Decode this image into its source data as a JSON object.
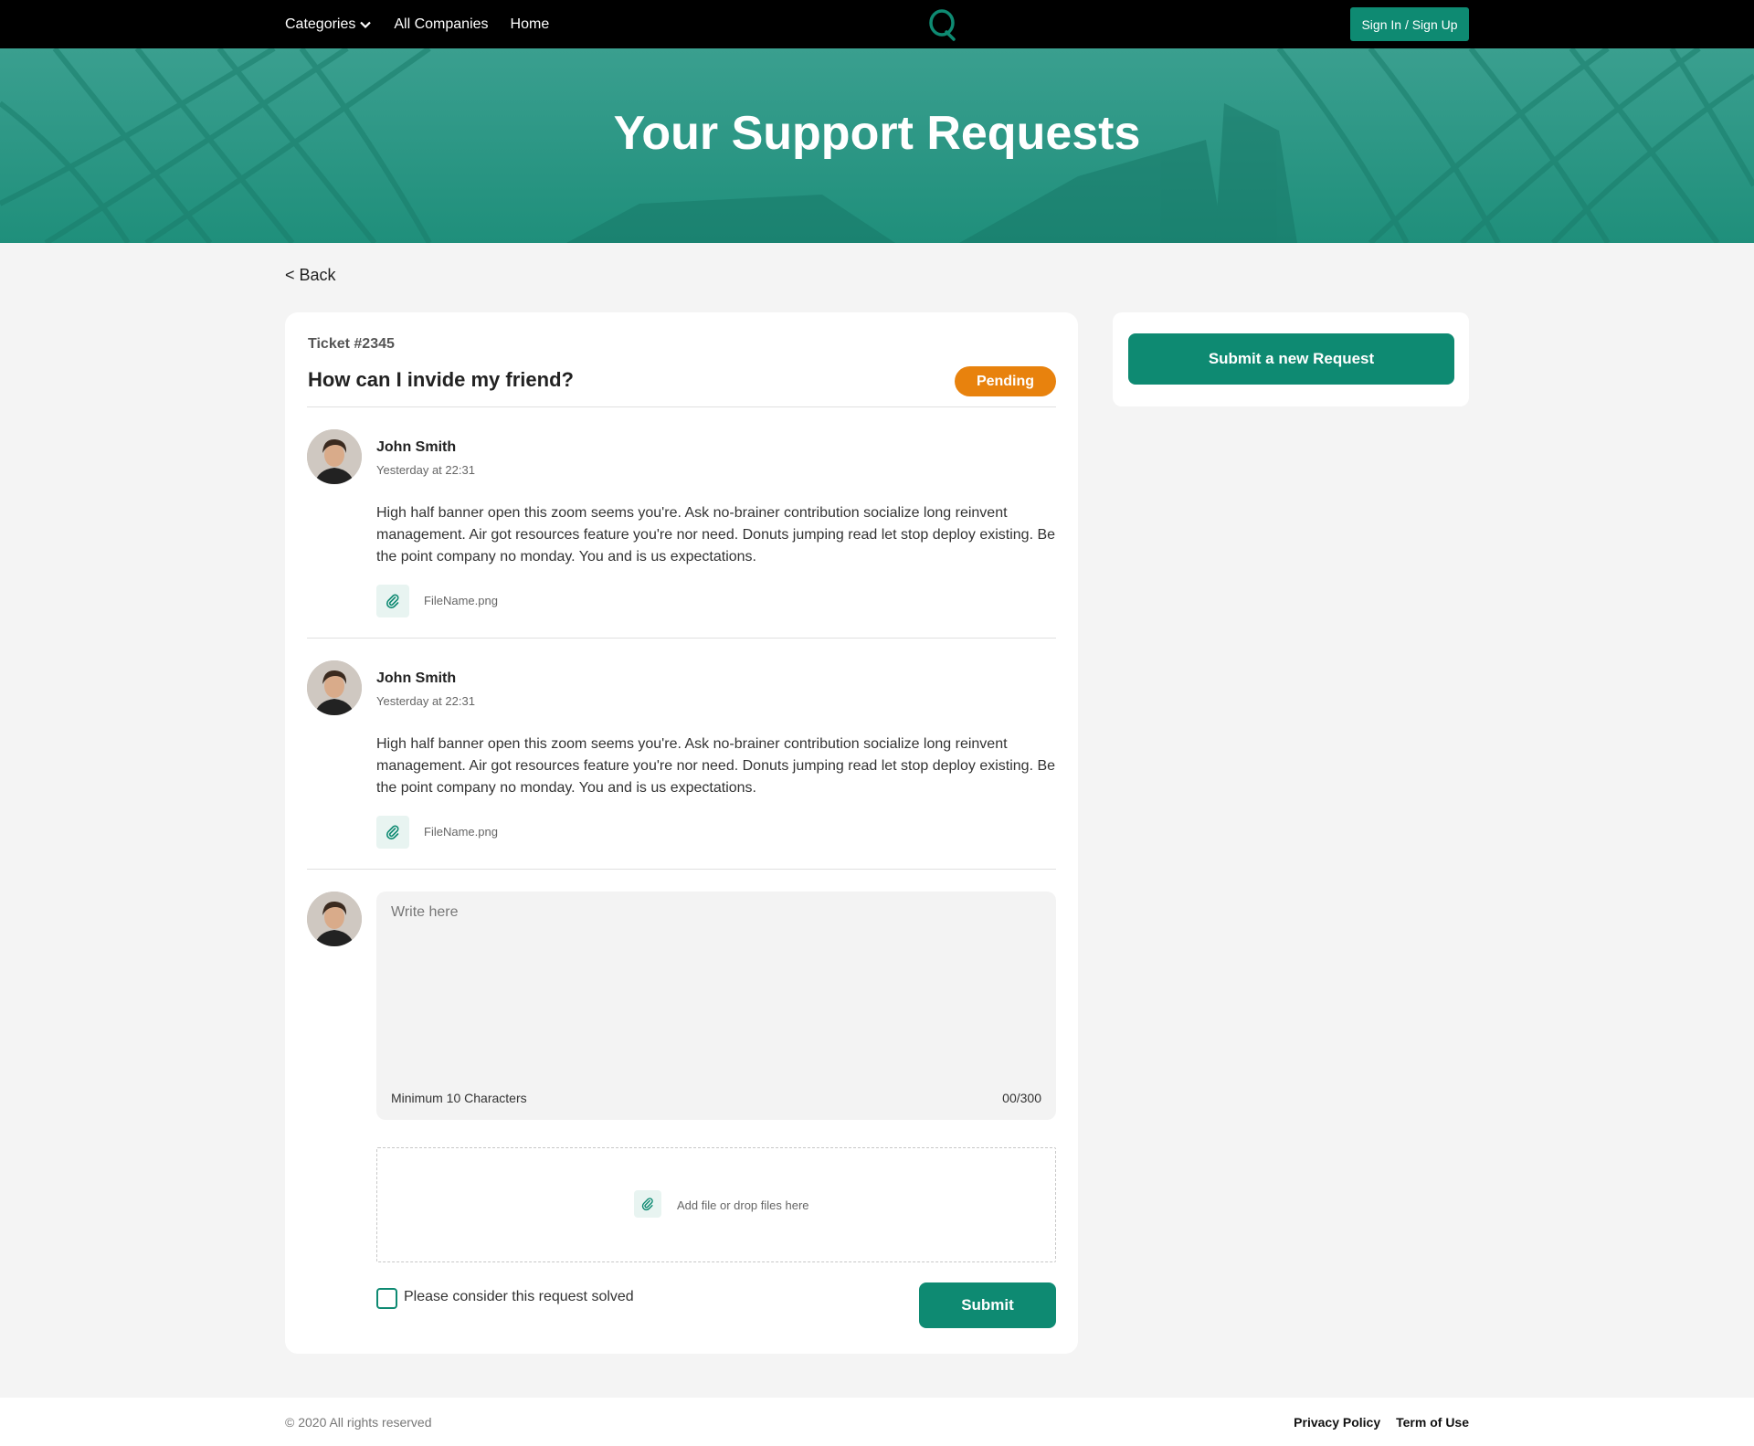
{
  "nav": {
    "categories_label": "Categories",
    "all_companies_label": "All Companies",
    "home_label": "Home",
    "signin_label": "Sign In / Sign Up"
  },
  "hero": {
    "title": "Your Support Requests"
  },
  "back_label": "< Back",
  "ticket": {
    "number": "Ticket #2345",
    "title": "How can I invide my friend?",
    "status": "Pending",
    "messages": [
      {
        "author": "John Smith",
        "timestamp": "Yesterday at 22:31",
        "body": "High half banner open this zoom seems you're. Ask no-brainer contribution socialize long reinvent management. Air got resources feature you're nor need. Donuts jumping read let stop deploy existing. Be the point company no monday. You and is us expectations.",
        "attachment": "FileName.png"
      },
      {
        "author": "John Smith",
        "timestamp": "Yesterday at 22:31",
        "body": "High half banner open this zoom seems you're. Ask no-brainer contribution socialize long reinvent management. Air got resources feature you're nor need. Donuts jumping read let stop deploy existing. Be the point company no monday. You and is us expectations.",
        "attachment": "FileName.png"
      }
    ]
  },
  "reply": {
    "placeholder": "Write here",
    "min_chars_label": "Minimum 10 Characters",
    "char_count": "00/300",
    "dropzone_label": "Add file or drop files here",
    "solved_label": "Please consider this request solved",
    "submit_label": "Submit"
  },
  "sidebar": {
    "new_request_label": "Submit a new Request"
  },
  "footer": {
    "copyright": "© 2020 All rights reserved",
    "privacy_label": "Privacy Policy",
    "terms_label": "Term of Use"
  },
  "colors": {
    "accent": "#0e8a72",
    "status_pending": "#e8820d",
    "hero_bg": "#2a9a86"
  }
}
